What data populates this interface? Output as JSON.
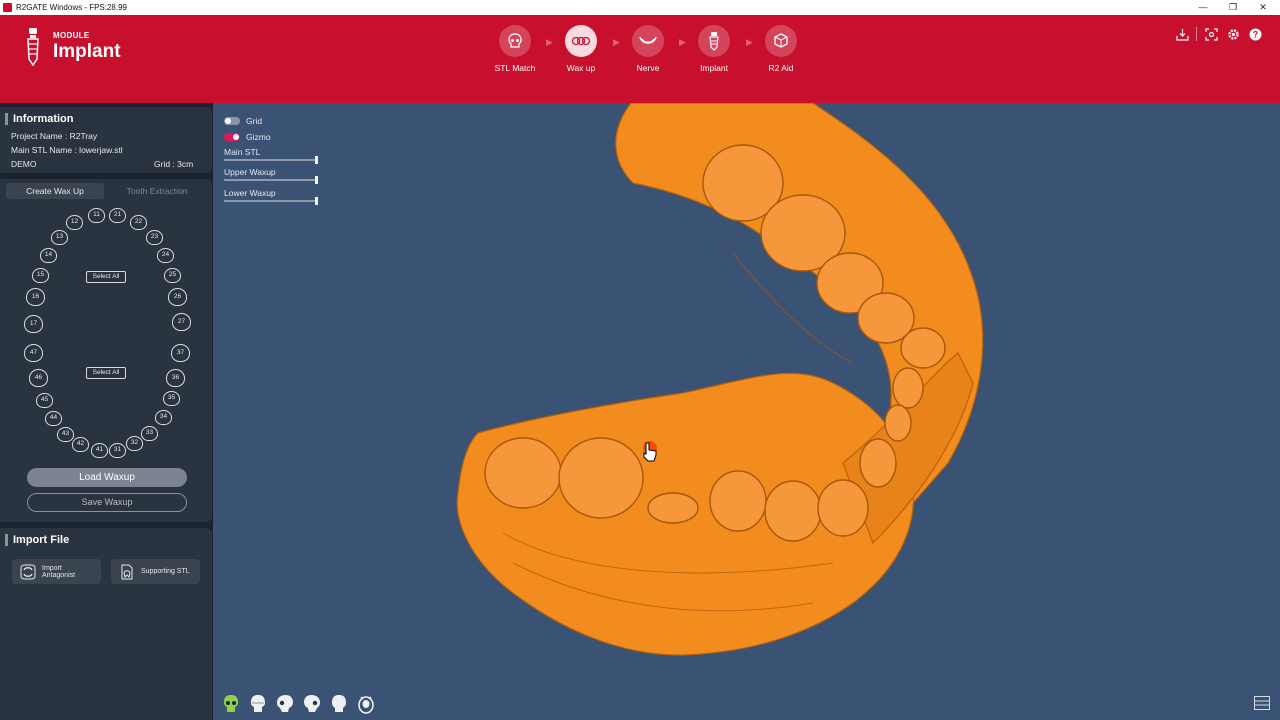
{
  "window": {
    "title": "R2GATE Windows - FPS:28.99",
    "controls": [
      "—",
      "❐",
      "✕"
    ]
  },
  "header": {
    "module_label": "MODULE",
    "module_title": "Implant",
    "steps": [
      {
        "label": "STL Match",
        "icon": "skull-icon",
        "active": false
      },
      {
        "label": "Wax up",
        "icon": "teeth-wax-icon",
        "active": true
      },
      {
        "label": "Nerve",
        "icon": "jaw-nerve-icon",
        "active": false
      },
      {
        "label": "Implant",
        "icon": "implant-icon",
        "active": false
      },
      {
        "label": "R2 Aid",
        "icon": "box-icon",
        "active": false
      }
    ],
    "tools": [
      "download-icon",
      "screenshot-icon",
      "settings-icon",
      "help-icon"
    ]
  },
  "information": {
    "title": "Information",
    "project_name": "Project Name : R2Tray",
    "main_stl": "Main STL Name : lowerjaw.stl",
    "mode": "DEMO",
    "grid": "Grid : 3cm"
  },
  "waxup": {
    "tab_active": "Create Wax Up",
    "tab_inactive": "Tooth Extraction",
    "upper_teeth": [
      "11",
      "21",
      "12",
      "22",
      "13",
      "23",
      "14",
      "24",
      "15",
      "25",
      "16",
      "26",
      "17",
      "27"
    ],
    "lower_teeth": [
      "47",
      "37",
      "46",
      "36",
      "45",
      "35",
      "44",
      "34",
      "43",
      "33",
      "42",
      "32",
      "41",
      "31"
    ],
    "select_all_upper": "Select All",
    "select_all_lower": "Select All",
    "load_label": "Load Waxup",
    "save_label": "Save Waxup"
  },
  "import_file": {
    "title": "Import File",
    "antagonist_label_1": "Import",
    "antagonist_label_2": "Antagonist",
    "supporting_label": "Supporting STL"
  },
  "viewport": {
    "grid_label": "Grid",
    "grid_on": false,
    "gizmo_label": "Gizmo",
    "gizmo_on": true,
    "sliders": [
      {
        "label": "Main STL",
        "value": 1.0
      },
      {
        "label": "Upper Waxup",
        "value": 1.0
      },
      {
        "label": "Lower Waxup",
        "value": 1.0
      }
    ],
    "bottom_views": [
      "skull-green-icon",
      "skull-front-icon",
      "skull-left-icon",
      "skull-right-icon",
      "skull-back-icon",
      "skull-top-icon"
    ],
    "model_color": "#f28c1e",
    "background_color": "#3a5273"
  },
  "colors": {
    "brand": "#c8102e",
    "panel": "#2a3340",
    "accent_pink": "#e0185a"
  }
}
